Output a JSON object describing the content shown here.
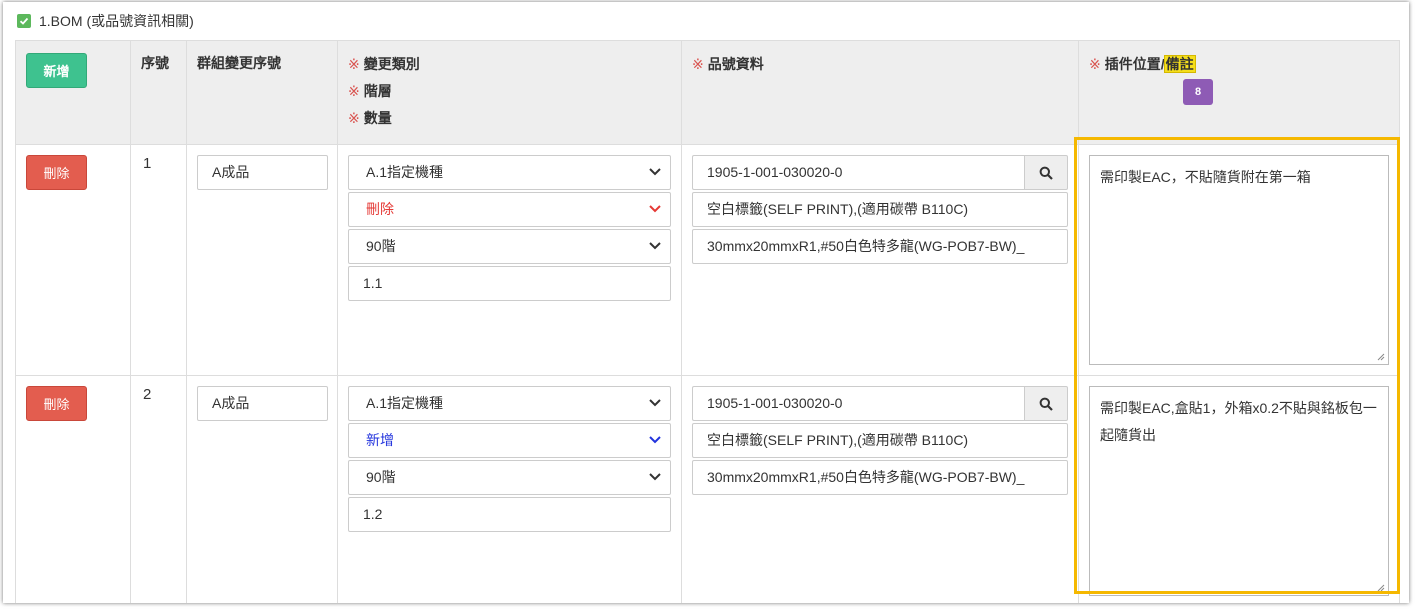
{
  "section": {
    "title": "1.BOM (或品號資訊相關)",
    "checked": true
  },
  "header": {
    "add_label": "新增",
    "seq": "序號",
    "group_seq": "群組變更序號",
    "req_mark": "※",
    "change_type": "變更類別",
    "level": "階層",
    "quantity": "數量",
    "part_info": "品號資料",
    "position_prefix": "插件位置/",
    "remark_word": "備註",
    "badge": "8"
  },
  "rows": [
    {
      "delete_label": "刪除",
      "seq": "1",
      "group": "A成品",
      "change_type": "A.1指定機種",
      "action": "刪除",
      "level": "90階",
      "quantity": "1.1",
      "part_no": "1905-1-001-030020-0",
      "part_name": "空白標籤(SELF PRINT),(適用碳帶 B110C)",
      "part_spec": "30mmx20mmxR1,#50白色特多龍(WG-POB7-BW)_",
      "remark": "需印製EAC，不貼隨貨附在第一箱"
    },
    {
      "delete_label": "刪除",
      "seq": "2",
      "group": "A成品",
      "change_type": "A.1指定機種",
      "action": "新增",
      "level": "90階",
      "quantity": "1.2",
      "part_no": "1905-1-001-030020-0",
      "part_name": "空白標籤(SELF PRINT),(適用碳帶 B110C)",
      "part_spec": "30mmx20mmxR1,#50白色特多龍(WG-POB7-BW)_",
      "remark": "需印製EAC,盒貼1，外箱x0.2不貼與銘板包一起隨貨出"
    }
  ],
  "colors": {
    "add_button": "#3ec28f",
    "delete_button": "#e35d4f",
    "highlight": "#f5b800",
    "badge": "#8e5bb5"
  }
}
